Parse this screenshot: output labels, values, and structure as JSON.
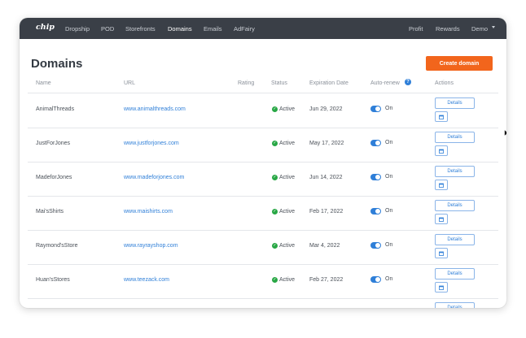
{
  "app": {
    "logo": "chip"
  },
  "nav": {
    "left": [
      "Dropship",
      "POD",
      "Storefronts",
      "Domains",
      "Emails",
      "AdFairy"
    ],
    "right": [
      "Profit",
      "Rewards",
      "Demo"
    ],
    "active": "Domains"
  },
  "page": {
    "title": "Domains",
    "create_label": "Create domain"
  },
  "table": {
    "headers": {
      "name": "Name",
      "url": "URL",
      "rating": "Rating",
      "status": "Status",
      "expiration": "Expiration Date",
      "autorenew": "Auto-renew",
      "actions": "Actions"
    },
    "details_label": "Details",
    "rows": [
      {
        "name": "AnimalThreads",
        "url": "www.animalthreads.com",
        "rating": "",
        "status": "Active",
        "expiration": "Jun 29, 2022",
        "autorenew": "On"
      },
      {
        "name": "JustForJones",
        "url": "www.justforjones.com",
        "rating": "",
        "status": "Active",
        "expiration": "May 17, 2022",
        "autorenew": "On"
      },
      {
        "name": "MadeforJones",
        "url": "www.madeforjones.com",
        "rating": "",
        "status": "Active",
        "expiration": "Jun 14, 2022",
        "autorenew": "On"
      },
      {
        "name": "Mai'sShirts",
        "url": "www.maishirts.com",
        "rating": "",
        "status": "Active",
        "expiration": "Feb 17, 2022",
        "autorenew": "On"
      },
      {
        "name": "Raymond'sStore",
        "url": "www.rayrayshop.com",
        "rating": "",
        "status": "Active",
        "expiration": "Mar 4, 2022",
        "autorenew": "On"
      },
      {
        "name": "Huan'sStores",
        "url": "www.teezack.com",
        "rating": "",
        "status": "Active",
        "expiration": "Feb 27, 2022",
        "autorenew": "On"
      }
    ]
  },
  "colors": {
    "topbar": "#3a3f47",
    "accent": "#f2651c",
    "link": "#2f7fd8",
    "active_status": "#28a745"
  },
  "icons": {
    "status": "check-circle-icon",
    "edit": "external-link-icon",
    "help": "question-circle-icon",
    "menu": "caret-down-icon"
  }
}
